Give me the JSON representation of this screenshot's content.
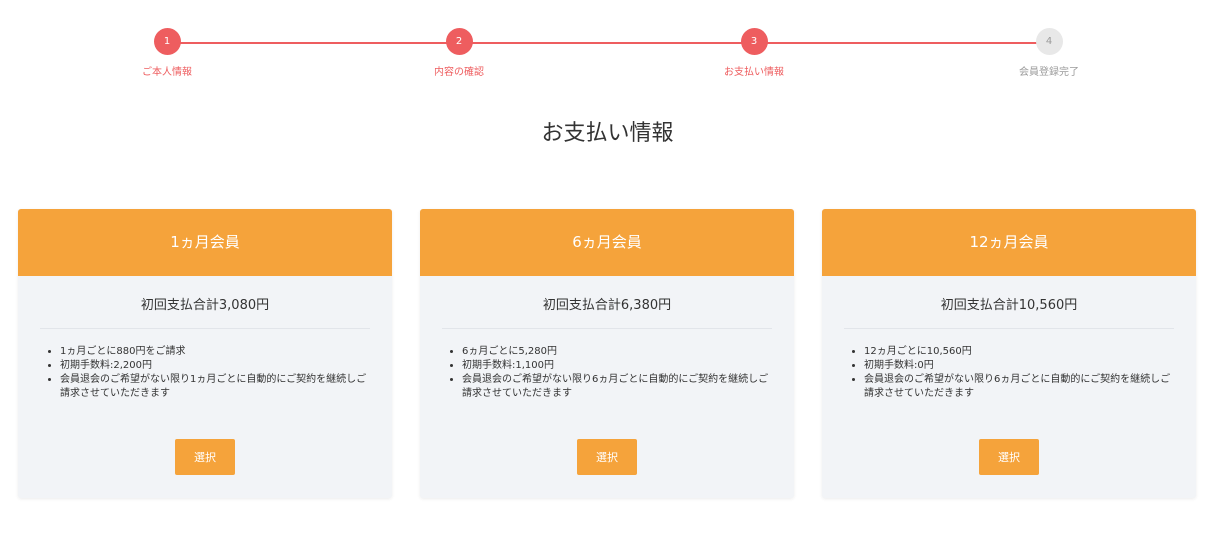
{
  "colors": {
    "accent_red": "#ee5d5f",
    "inactive_gray": "#e8e8e8",
    "inactive_text": "#9a9a9a",
    "orange": "#f5a33b"
  },
  "stepper": {
    "steps": [
      {
        "number": "1",
        "label": "ご本人情報",
        "state": "done"
      },
      {
        "number": "2",
        "label": "内容の確認",
        "state": "done"
      },
      {
        "number": "3",
        "label": "お支払い情報",
        "state": "current"
      },
      {
        "number": "4",
        "label": "会員登録完了",
        "state": "pending"
      }
    ]
  },
  "page": {
    "title": "お支払い情報"
  },
  "plans": [
    {
      "name": "1ヵ月会員",
      "total": "初回支払合計3,080円",
      "details": [
        "1ヵ月ごとに880円をご請求",
        "初期手数料:2,200円",
        "会員退会のご希望がない限り1ヵ月ごとに自動的にご契約を継続しご請求させていただきます"
      ],
      "button_label": "選択"
    },
    {
      "name": "6ヵ月会員",
      "total": "初回支払合計6,380円",
      "details": [
        "6ヵ月ごとに5,280円",
        "初期手数料:1,100円",
        "会員退会のご希望がない限り6ヵ月ごとに自動的にご契約を継続しご請求させていただきます"
      ],
      "button_label": "選択"
    },
    {
      "name": "12ヵ月会員",
      "total": "初回支払合計10,560円",
      "details": [
        "12ヵ月ごとに10,560円",
        "初期手数料:0円",
        "会員退会のご希望がない限り6ヵ月ごとに自動的にご契約を継続しご請求させていただきます"
      ],
      "button_label": "選択"
    }
  ]
}
